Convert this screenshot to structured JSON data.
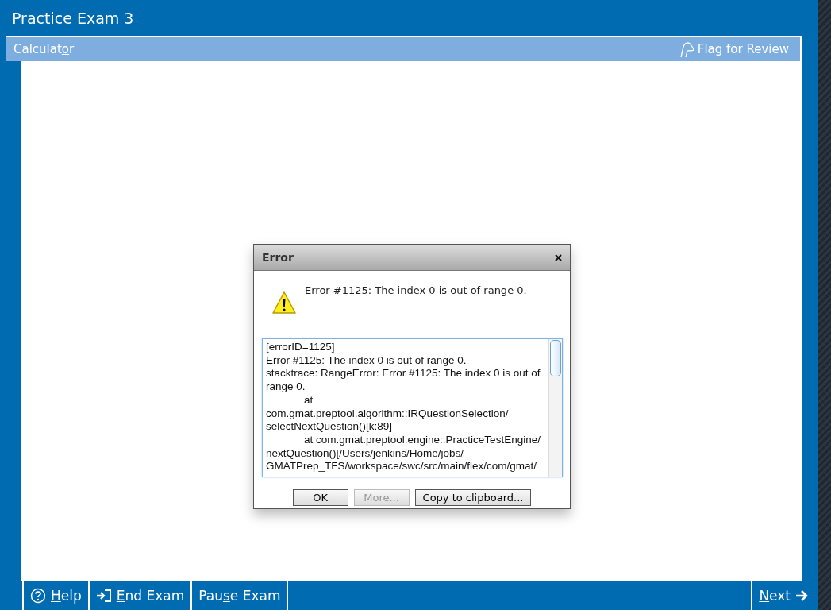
{
  "window": {
    "title": "Practice Exam 3"
  },
  "toolbar": {
    "left": {
      "pre": "Calculat",
      "key": "o",
      "post": "r"
    },
    "right": {
      "label": "Flag for Review"
    }
  },
  "dialog": {
    "title": "Error",
    "message": "Error #1125: The index 0 is out of range 0.",
    "details": [
      {
        "text": "[errorID=1125]",
        "indented": false
      },
      {
        "text": "Error #1125: The index 0 is out of range 0.",
        "indented": false
      },
      {
        "text": "stacktrace: RangeError: Error #1125: The index 0 is out of range 0.",
        "indented": false
      },
      {
        "text": "at",
        "indented": true
      },
      {
        "text": "com.gmat.preptool.algorithm::IRQuestionSelection/ selectNextQuestion()[k:89]",
        "indented": false
      },
      {
        "text": "at com.gmat.preptool.engine::PracticeTestEngine/ nextQuestion()[/Users/jenkins/Home/jobs/ GMATPrep_TFS/workspace/swc/src/main/flex/com/gmat/",
        "indented": true
      }
    ],
    "buttons": [
      {
        "label": "OK",
        "disabled": false
      },
      {
        "label": "More...",
        "disabled": true
      },
      {
        "label": "Copy to clipboard...",
        "disabled": false
      }
    ]
  },
  "bottom_bar": {
    "left": [
      {
        "kind": "help",
        "key": "H",
        "post": "elp"
      },
      {
        "kind": "end",
        "key": "E",
        "post": "nd Exam"
      },
      {
        "kind": "plain",
        "pre": "Pau",
        "key": "s",
        "post": "e Exam"
      }
    ],
    "right": {
      "kind": "next",
      "key": "N",
      "post": "ext"
    }
  }
}
